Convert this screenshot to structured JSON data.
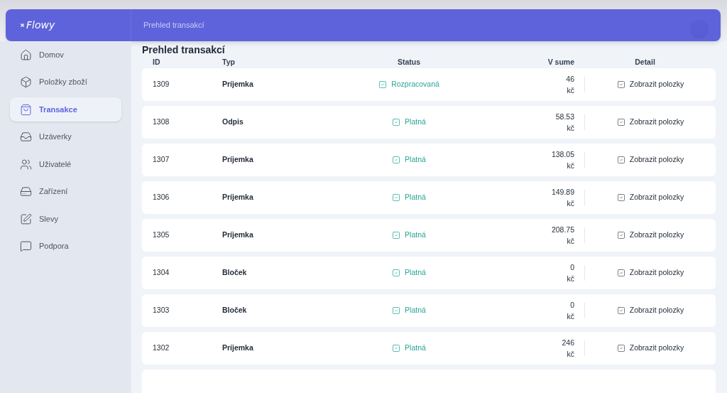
{
  "header": {
    "logo": "Flowy",
    "page_title": "Prehled transakcí"
  },
  "sidebar": {
    "items": [
      {
        "label": "Domov",
        "kind": "home",
        "selected": false
      },
      {
        "label": "Položky zboží",
        "kind": "box",
        "selected": false
      },
      {
        "label": "Transakce",
        "kind": "bag",
        "selected": true
      },
      {
        "label": "Uzáverky",
        "kind": "inbox",
        "selected": false
      },
      {
        "label": "Uživatelé",
        "kind": "users",
        "selected": false
      },
      {
        "label": "Zařízení",
        "kind": "drive",
        "selected": false
      },
      {
        "label": "Slevy",
        "kind": "edit",
        "selected": false
      },
      {
        "label": "Podpora",
        "kind": "chat",
        "selected": false
      }
    ]
  },
  "content": {
    "title": "Prehled transakcí",
    "table": {
      "columns": [
        "ID",
        "Typ",
        "Status",
        "V sume",
        "Detail"
      ],
      "rows": [
        {
          "id": "1309",
          "type": "Príjemka",
          "status": "Rozpracovaná",
          "amount": "46",
          "currency": "kč",
          "detail": "Zobrazit polozky"
        },
        {
          "id": "1308",
          "type": "Odpis",
          "status": "Platná",
          "amount": "58.53",
          "currency": "kč",
          "detail": "Zobrazit polozky"
        },
        {
          "id": "1307",
          "type": "Príjemka",
          "status": "Platná",
          "amount": "138.05",
          "currency": "kč",
          "detail": "Zobrazit polozky"
        },
        {
          "id": "1306",
          "type": "Príjemka",
          "status": "Platná",
          "amount": "149.89",
          "currency": "kč",
          "detail": "Zobrazit polozky"
        },
        {
          "id": "1305",
          "type": "Príjemka",
          "status": "Platná",
          "amount": "208.75",
          "currency": "kč",
          "detail": "Zobrazit polozky"
        },
        {
          "id": "1304",
          "type": "Bloček",
          "status": "Platná",
          "amount": "0",
          "currency": "kč",
          "detail": "Zobrazit polozky"
        },
        {
          "id": "1303",
          "type": "Bloček",
          "status": "Platná",
          "amount": "0",
          "currency": "kč",
          "detail": "Zobrazit polozky"
        },
        {
          "id": "1302",
          "type": "Príjemka",
          "status": "Platná",
          "amount": "246",
          "currency": "kč",
          "detail": "Zobrazit polozky"
        }
      ]
    }
  }
}
